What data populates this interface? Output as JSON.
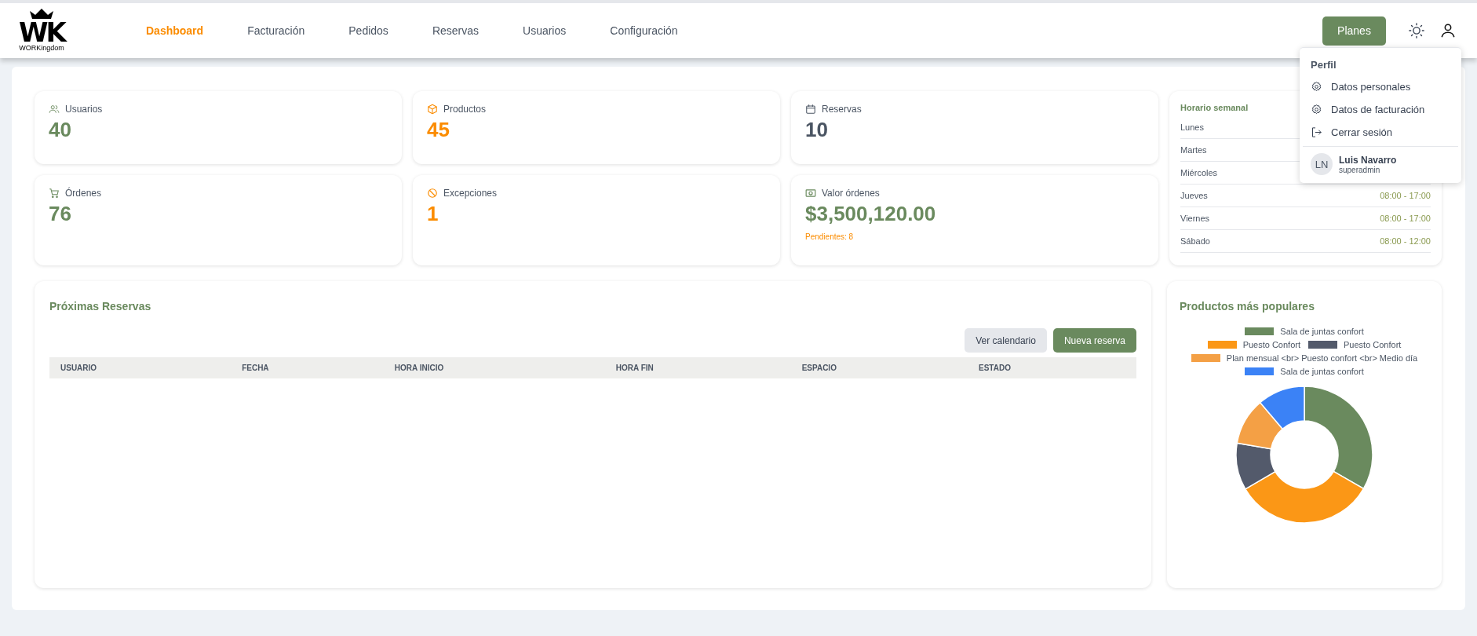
{
  "logo": {
    "mark": "WK",
    "name": "WORKingdom"
  },
  "nav": [
    {
      "label": "Dashboard",
      "selected": true
    },
    {
      "label": "Facturación",
      "selected": false
    },
    {
      "label": "Pedidos",
      "selected": false
    },
    {
      "label": "Reservas",
      "selected": false
    },
    {
      "label": "Usuarios",
      "selected": false
    },
    {
      "label": "Configuración",
      "selected": false
    }
  ],
  "plans_button": "Planes",
  "profile_menu": {
    "title": "Perfil",
    "items": [
      {
        "label": "Datos personales"
      },
      {
        "label": "Datos de facturación"
      },
      {
        "label": "Cerrar sesión"
      }
    ],
    "user": {
      "initials": "LN",
      "name": "Luis Navarro",
      "role": "superadmin"
    }
  },
  "stats": [
    {
      "label": "Usuarios",
      "value": "40",
      "color": "#6a8a5e"
    },
    {
      "label": "Productos",
      "value": "45",
      "color": "#fb8c00"
    },
    {
      "label": "Reservas",
      "value": "10",
      "color": "#4b5563"
    },
    {
      "label": "Órdenes",
      "value": "76",
      "color": "#6a8a5e"
    },
    {
      "label": "Excepciones",
      "value": "1",
      "color": "#fb8c00"
    },
    {
      "label": "Valor órdenes",
      "value": "$3,500,120.00",
      "color": "#6a8a5e",
      "note": "Pendientes: 8"
    }
  ],
  "schedule": {
    "title": "Horario semanal",
    "days": [
      {
        "day": "Lunes"
      },
      {
        "day": "Martes"
      },
      {
        "day": "Miércoles"
      },
      {
        "day": "Jueves",
        "hours": "08:00 - 17:00"
      },
      {
        "day": "Viernes",
        "hours": "08:00 - 17:00"
      },
      {
        "day": "Sábado",
        "hours": "08:00 - 12:00"
      }
    ]
  },
  "reservations": {
    "title": "Próximas Reservas",
    "buttons": [
      {
        "kind": "secondary",
        "label": "Ver calendario"
      },
      {
        "kind": "primary",
        "label": "Nueva reserva"
      }
    ],
    "columns": [
      "USUARIO",
      "FECHA",
      "HORA INICIO",
      "HORA FIN",
      "ESPACIO",
      "ESTADO"
    ]
  },
  "popular": {
    "title": "Productos más populares",
    "chart_data": {
      "type": "donut",
      "categories": [
        "Sala de juntas confort",
        "Puesto Confort",
        "Puesto Confort",
        "Plan mensual <br> Puesto confort <br> Medio día",
        "Sala de juntas confort"
      ],
      "values": [
        33.3,
        33.3,
        11.1,
        11.1,
        11.2
      ],
      "legend": true,
      "colors": [
        "#6a8a5e",
        "#fb9716",
        "#535a6b",
        "#f4a045",
        "#3b82f6"
      ]
    }
  }
}
